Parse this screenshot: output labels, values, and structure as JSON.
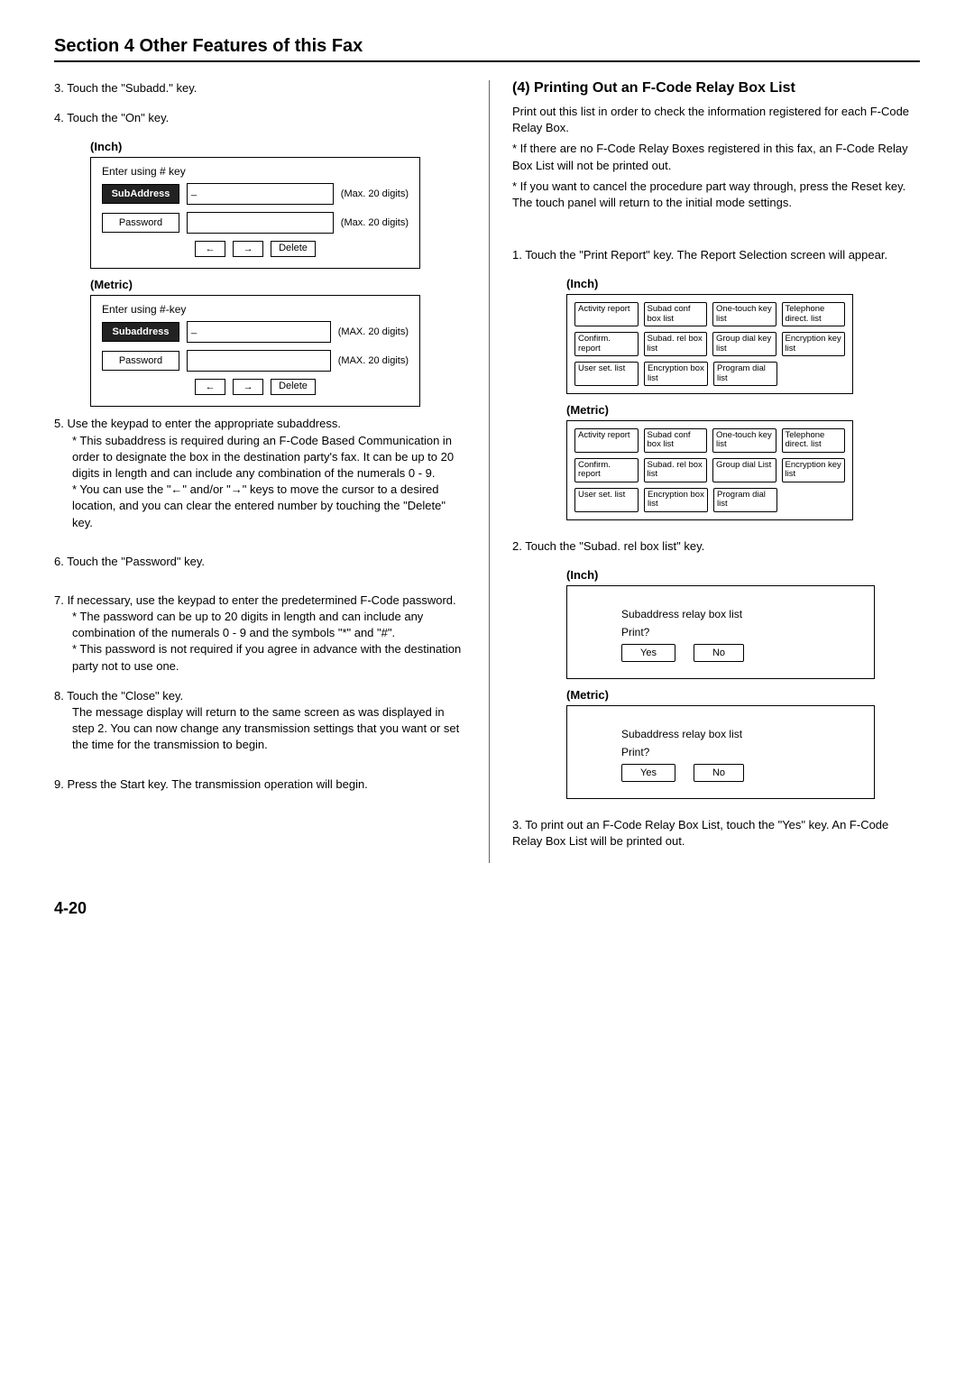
{
  "page": {
    "section_title": "Section 4 Other Features of this Fax",
    "page_number": "4-20"
  },
  "left": {
    "step3": "3. Touch the \"Subadd.\" key.",
    "step4": "4. Touch the \"On\" key.",
    "label_inch": "(Inch)",
    "label_metric": "(Metric)",
    "panel_inch": {
      "enter": "Enter using # key",
      "subaddress_label": "SubAddress",
      "sub_value": "_",
      "password_label": "Password",
      "limit": "(Max. 20 digits)",
      "delete": "Delete",
      "arrow_left": "←",
      "arrow_right": "→"
    },
    "panel_metric": {
      "enter": "Enter using #-key",
      "subaddress_label": "Subaddress",
      "sub_value": "_",
      "password_label": "Password",
      "limit": "(MAX. 20 digits)",
      "delete": "Delete",
      "arrow_left": "←",
      "arrow_right": "→"
    },
    "step5": "5. Use the keypad to enter the appropriate subaddress.",
    "step5_sub1": "* This subaddress is required during an F-Code Based Communication in order to designate the box in the destination party's fax. It can be up to 20 digits in length and can include any combination of the numerals 0 - 9.",
    "step5_sub2": "* You can use the \"←\" and/or \"→\" keys to move the cursor to a desired location, and you can clear the entered number by touching the \"Delete\" key.",
    "step6": "6. Touch the \"Password\" key.",
    "step7": "7. If necessary, use the keypad to enter the predetermined F-Code password.",
    "step7_sub1": "* The password can be up to 20 digits in length and can include any combination of the numerals 0 - 9 and the symbols \"*\" and \"#\".",
    "step7_sub2": "* This password is not required if you agree in advance with the destination party not to use one.",
    "step8": "8. Touch the \"Close\" key.",
    "step8_body": "The message display will return to the same screen as was displayed in step 2. You can now change any transmission settings that you want or set the time for the transmission to begin.",
    "step9": "9. Press the Start key. The transmission operation will begin."
  },
  "right": {
    "heading": "(4) Printing Out an F-Code Relay Box List",
    "intro": "Print out this list in order to check the information registered for each F-Code Relay Box.",
    "note1": "* If there are no F-Code Relay Boxes registered in this fax, an F-Code Relay Box List will not be printed out.",
    "note2": "* If you want to cancel the procedure part way through, press the Reset key. The touch panel will return to the initial mode settings.",
    "step1": "1. Touch the \"Print Report\" key. The Report Selection screen will appear.",
    "label_inch": "(Inch)",
    "label_metric": "(Metric)",
    "grid_inch": {
      "r1": [
        "Activity report",
        "Subad conf box list",
        "One-touch key list",
        "Telephone direct. list"
      ],
      "r2": [
        "Confirm. report",
        "Subad. rel box list",
        "Group dial key list",
        "Encryption key list"
      ],
      "r3": [
        "User set. list",
        "Encryption box list",
        "Program dial list",
        ""
      ]
    },
    "grid_metric": {
      "r1": [
        "Activity report",
        "Subad conf box list",
        "One-touch key list",
        "Telephone direct. list"
      ],
      "r2": [
        "Confirm. report",
        "Subad. rel box list",
        "Group dial List",
        "Encryption key list"
      ],
      "r3": [
        "User set. list",
        "Encryption box list",
        "Program dial list",
        ""
      ]
    },
    "step2": "2. Touch the \"Subad. rel box list\" key.",
    "confirm_inch": {
      "title": "Subaddress relay box list",
      "prompt": "Print?",
      "yes": "Yes",
      "no": "No"
    },
    "confirm_metric": {
      "title": "Subaddress relay box list",
      "prompt": "Print?",
      "yes": "Yes",
      "no": "No"
    },
    "step3": "3. To print out an F-Code Relay Box List, touch the \"Yes\" key. An F-Code Relay Box List will be printed out."
  }
}
